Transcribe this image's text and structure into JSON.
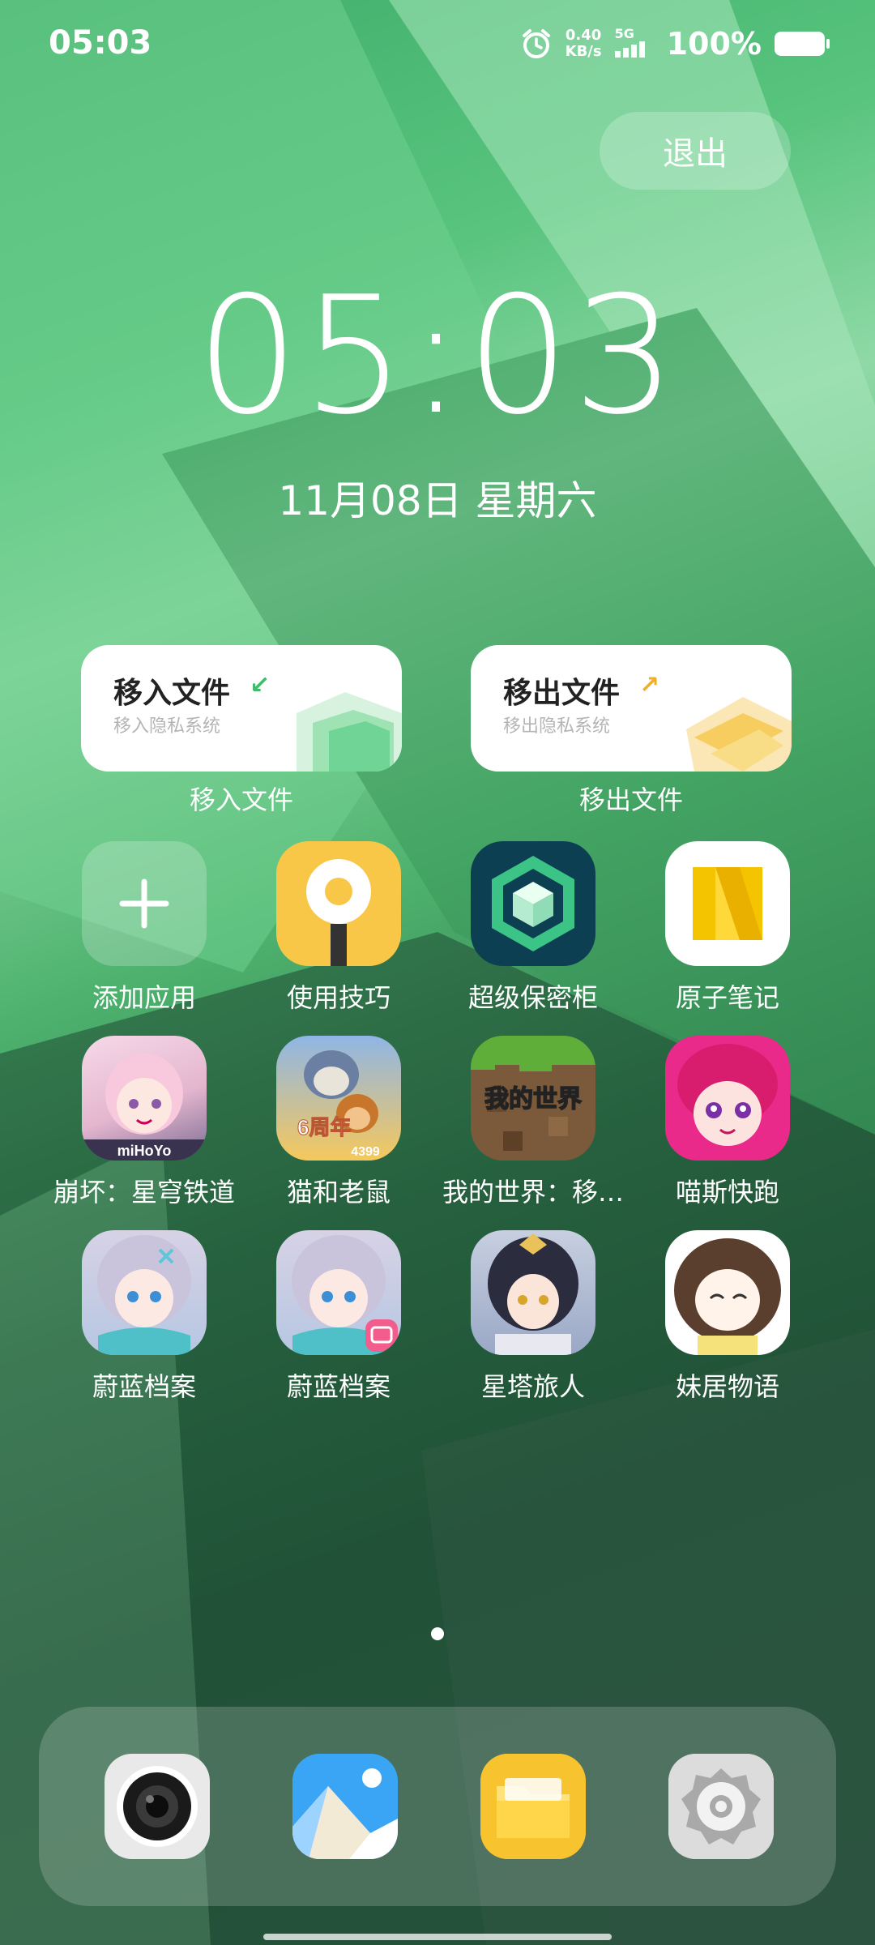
{
  "status_bar": {
    "time": "05:03",
    "net_speed_value": "0.40",
    "net_speed_unit": "KB/s",
    "network_type": "5G",
    "battery_percent": "100%",
    "icons": [
      "alarm-icon",
      "signal-icon",
      "battery-icon"
    ]
  },
  "exit_button": {
    "label": "退出"
  },
  "clock": {
    "time": "05:03",
    "date": "11月08日 星期六"
  },
  "widgets": [
    {
      "title": "移入文件",
      "arrow": "↙",
      "subtitle": "移入隐私系统",
      "caption": "移入文件",
      "accent": "#3dbd6a"
    },
    {
      "title": "移出文件",
      "arrow": "↗",
      "subtitle": "移出隐私系统",
      "caption": "移出文件",
      "accent": "#f1b021"
    }
  ],
  "apps": [
    {
      "label": "添加应用",
      "icon": "add-icon"
    },
    {
      "label": "使用技巧",
      "icon": "tips-bulb-icon"
    },
    {
      "label": "超级保密柜",
      "icon": "vault-cube-icon"
    },
    {
      "label": "原子笔记",
      "icon": "notes-n-icon"
    },
    {
      "label": "崩坏：星穹铁道",
      "icon": "game-anime-girl-icon",
      "badge": "miHoYo"
    },
    {
      "label": "猫和老鼠",
      "icon": "game-tom-jerry-icon",
      "badge": "6周年",
      "badge2": "4399"
    },
    {
      "label": "我的世界：移…",
      "icon": "game-minecraft-icon",
      "badge": "我的世界"
    },
    {
      "label": "喵斯快跑",
      "icon": "game-muse-dash-icon"
    },
    {
      "label": "蔚蓝档案",
      "icon": "game-blue-archive-icon"
    },
    {
      "label": "蔚蓝档案",
      "icon": "game-blue-archive-bili-icon"
    },
    {
      "label": "星塔旅人",
      "icon": "game-star-tower-icon"
    },
    {
      "label": "妹居物语",
      "icon": "game-sister-life-icon"
    }
  ],
  "dock": [
    {
      "icon": "camera-icon"
    },
    {
      "icon": "gallery-icon"
    },
    {
      "icon": "files-folder-icon"
    },
    {
      "icon": "settings-gear-icon"
    }
  ]
}
